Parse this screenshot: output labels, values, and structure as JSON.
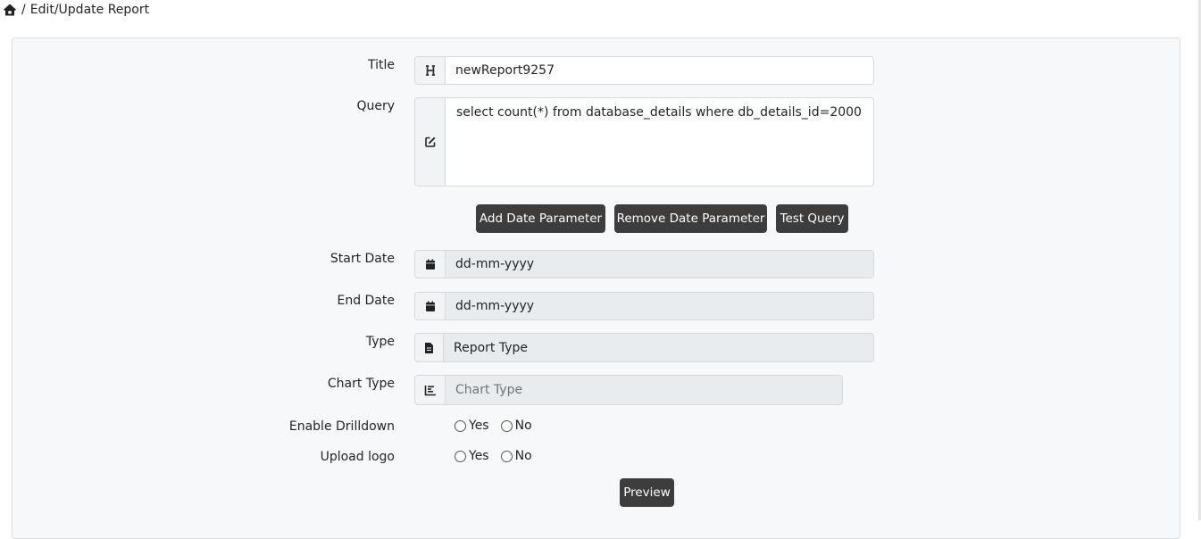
{
  "breadcrumb": {
    "home_icon": "home-icon",
    "separator": "/",
    "current": "Edit/Update Report"
  },
  "form": {
    "title": {
      "label": "Title",
      "icon": "heading-icon",
      "value": "newReport9257"
    },
    "query": {
      "label": "Query",
      "icon": "edit-icon",
      "value": "select count(*) from database_details where db_details_id=2000"
    },
    "buttons": {
      "add_date": "Add Date Parameter",
      "remove_date": "Remove Date Parameter",
      "test_query": "Test Query"
    },
    "start_date": {
      "label": "Start Date",
      "icon": "calendar-icon",
      "placeholder": "dd-mm-yyyy"
    },
    "end_date": {
      "label": "End Date",
      "icon": "calendar-icon",
      "placeholder": "dd-mm-yyyy"
    },
    "type": {
      "label": "Type",
      "icon": "file-icon",
      "value": "Report Type"
    },
    "chart_type": {
      "label": "Chart Type",
      "icon": "chart-icon",
      "placeholder": "Chart Type"
    },
    "enable_drilldown": {
      "label": "Enable Drilldown",
      "yes": "Yes",
      "no": "No"
    },
    "upload_logo": {
      "label": "Upload logo",
      "yes": "Yes",
      "no": "No"
    },
    "preview": "Preview"
  },
  "colors": {
    "button_bg": "#3d3d3d",
    "card_bg": "#f7f8fa",
    "readonly_bg": "#e9ecef"
  }
}
